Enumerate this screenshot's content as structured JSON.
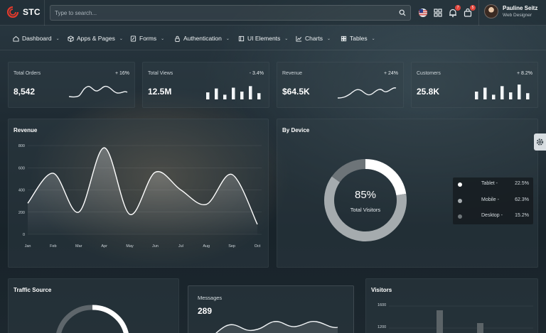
{
  "app": {
    "name": "STC"
  },
  "search": {
    "placeholder": "Type to search..."
  },
  "topbar": {
    "notifications_count": "7",
    "cart_count": "5",
    "icons": [
      "flag-icon",
      "grid-icon",
      "bell-icon",
      "cart-icon"
    ]
  },
  "user": {
    "name": "Pauline Seitz",
    "role": "Web Designer"
  },
  "nav": [
    {
      "label": "Dashboard",
      "icon": "home-icon"
    },
    {
      "label": "Apps & Pages",
      "icon": "cube-icon"
    },
    {
      "label": "Forms",
      "icon": "form-icon"
    },
    {
      "label": "Authentication",
      "icon": "lock-icon"
    },
    {
      "label": "UI Elements",
      "icon": "ui-icon"
    },
    {
      "label": "Charts",
      "icon": "chart-icon"
    },
    {
      "label": "Tables",
      "icon": "table-icon"
    }
  ],
  "stats": [
    {
      "title": "Total Orders",
      "change": "+ 16%",
      "value": "8,542",
      "spark": "line"
    },
    {
      "title": "Total Views",
      "change": "- 3.4%",
      "value": "12.5M",
      "spark": "bars",
      "bars": [
        0.45,
        0.7,
        0.3,
        0.75,
        0.5,
        0.85,
        0.4
      ]
    },
    {
      "title": "Revenue",
      "change": "+ 24%",
      "value": "$64.5K",
      "spark": "line"
    },
    {
      "title": "Customers",
      "change": "+ 8.2%",
      "value": "25.8K",
      "spark": "bars",
      "bars": [
        0.5,
        0.75,
        0.3,
        0.85,
        0.45,
        0.95,
        0.4
      ]
    }
  ],
  "revenue": {
    "title": "Revenue",
    "chart_data": {
      "type": "area",
      "categories": [
        "Jan",
        "Feb",
        "Mar",
        "Apr",
        "May",
        "Jun",
        "Jul",
        "Aug",
        "Sep",
        "Oct"
      ],
      "series": [
        {
          "values": [
            280,
            550,
            200,
            780,
            180,
            560,
            400,
            270,
            540,
            90
          ]
        }
      ],
      "ylim": [
        0,
        800
      ],
      "yticks": [
        0,
        200,
        400,
        600,
        800
      ],
      "grid": true
    }
  },
  "device": {
    "title": "By Device",
    "center_value": "85%",
    "center_label": "Total Visitors",
    "chart_data": {
      "type": "pie",
      "categories": [
        "Tablet",
        "Mobile",
        "Desktop"
      ],
      "values": [
        22.5,
        62.3,
        15.2
      ],
      "colors": [
        "#ffffff",
        "#a5abae",
        "#6d7478"
      ]
    },
    "legend": [
      {
        "label": "Tablet -",
        "value": "22.5%",
        "color": "#ffffff"
      },
      {
        "label": "Mobile -",
        "value": "62.3%",
        "color": "#a5abae"
      },
      {
        "label": "Desktop -",
        "value": "15.2%",
        "color": "#6d7478"
      }
    ]
  },
  "traffic": {
    "title": "Traffic Source"
  },
  "messages": {
    "title": "Messages",
    "value": "289"
  },
  "visitors": {
    "title": "Visitors",
    "yticks": [
      "1600",
      "1200"
    ]
  }
}
